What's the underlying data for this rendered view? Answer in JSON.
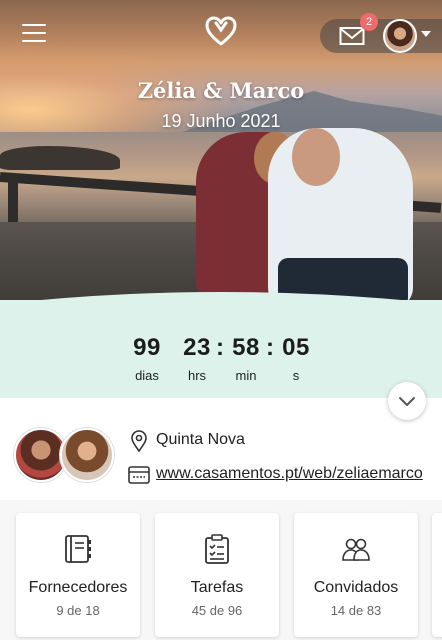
{
  "header": {
    "menu_icon": "hamburger-menu-icon",
    "logo_icon": "heart-logo-icon",
    "mail_icon": "envelope-icon",
    "notification_count": "2",
    "avatar_icon": "user-avatar"
  },
  "hero": {
    "couple_names": "Zélia & Marco",
    "wedding_date": "19 Junho 2021"
  },
  "countdown": {
    "days": "99",
    "days_label": "dias",
    "hours": "23",
    "hours_label": "hrs",
    "minutes": "58",
    "minutes_label": "min",
    "seconds": "05",
    "seconds_label": "s",
    "separator": ":"
  },
  "details": {
    "venue": "Quinta Nova",
    "website": "www.casamentos.pt/web/zeliaemarco",
    "venue_icon": "location-pin-icon",
    "website_icon": "browser-window-icon"
  },
  "cards": [
    {
      "title": "Fornecedores",
      "count": "9 de 18",
      "icon": "notebook-icon"
    },
    {
      "title": "Tarefas",
      "count": "45 de 96",
      "icon": "clipboard-checklist-icon"
    },
    {
      "title": "Convidados",
      "count": "14 de 83",
      "icon": "guests-icon"
    }
  ],
  "colors": {
    "countdown_bg": "#def2ec",
    "badge": "#ef6a6a",
    "text": "#222222"
  }
}
